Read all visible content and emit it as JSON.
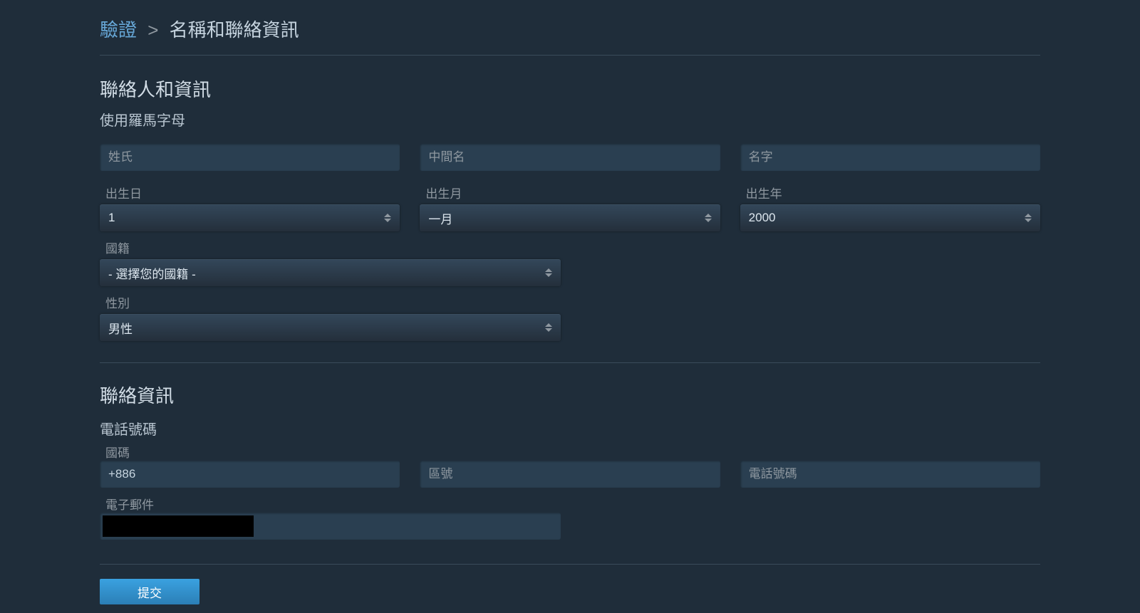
{
  "breadcrumb": {
    "link": "驗證",
    "sep": ">",
    "current": "名稱和聯絡資訊"
  },
  "section1": {
    "title": "聯絡人和資訊",
    "subtitle": "使用羅馬字母"
  },
  "name": {
    "last_placeholder": "姓氏",
    "middle_placeholder": "中間名",
    "first_placeholder": "名字"
  },
  "dob": {
    "day_label": "出生日",
    "day_value": "1",
    "month_label": "出生月",
    "month_value": "一月",
    "year_label": "出生年",
    "year_value": "2000"
  },
  "nationality": {
    "label": "國籍",
    "value": "- 選擇您的國籍 -"
  },
  "gender": {
    "label": "性別",
    "value": "男性"
  },
  "section2": {
    "title": "聯絡資訊",
    "subtitle": "電話號碼"
  },
  "phone": {
    "country_label": "國碼",
    "country_value": "+886",
    "area_placeholder": "區號",
    "number_placeholder": "電話號碼"
  },
  "email": {
    "label": "電子郵件"
  },
  "submit": {
    "label": "提交"
  }
}
